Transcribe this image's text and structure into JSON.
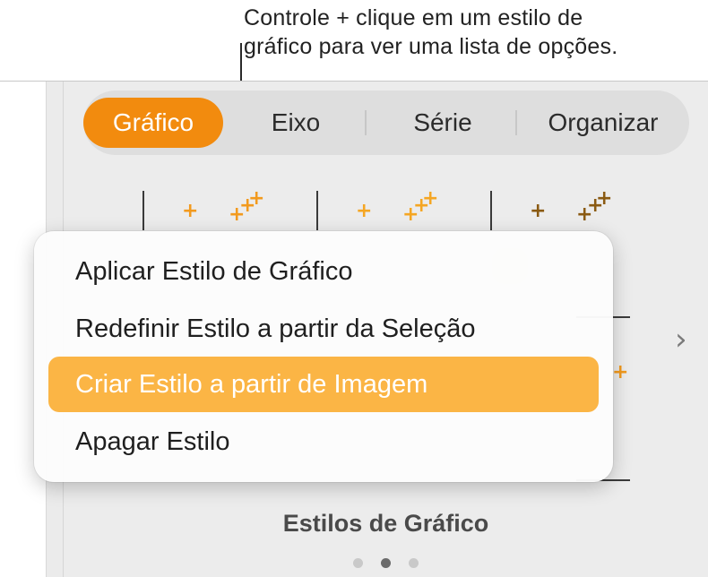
{
  "callout": {
    "line1": "Controle + clique em um estilo de",
    "line2": "gráfico para ver uma lista de opções."
  },
  "inspector": {
    "tabs": [
      {
        "label": "Gráfico",
        "active": true
      },
      {
        "label": "Eixo",
        "active": false
      },
      {
        "label": "Série",
        "active": false
      },
      {
        "label": "Organizar",
        "active": false
      }
    ],
    "section_title": "Estilos de Gráfico",
    "next_icon": "chevron-right-icon",
    "page_count": 3,
    "current_page": 2
  },
  "context_menu": {
    "items": [
      {
        "label": "Aplicar Estilo de Gráfico",
        "highlighted": false
      },
      {
        "label": "Redefinir Estilo a partir da Seleção",
        "highlighted": false
      },
      {
        "label": "Criar Estilo a partir de Imagem",
        "highlighted": true
      },
      {
        "label": "Apagar Estilo",
        "highlighted": false
      }
    ]
  },
  "colors": {
    "accent": "#f28b0e",
    "menu_highlight": "#fbb545",
    "style1": "#f29a1e",
    "style2": "#f5a623",
    "style3": "#8a5a12"
  }
}
